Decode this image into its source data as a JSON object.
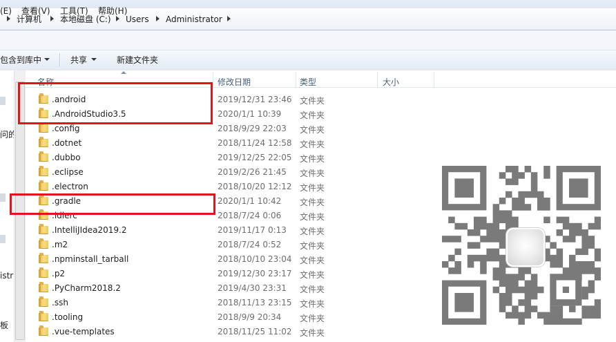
{
  "address_bar": {
    "crumbs": [
      "计算机",
      "本地磁盘 (C:)",
      "Users",
      "Administrator"
    ]
  },
  "menu": [
    "(E)",
    "查看(V)",
    "工具(T)",
    "帮助(H)"
  ],
  "toolbar": {
    "include_library": "包含到库中",
    "share": "共享",
    "new_folder": "新建文件夹"
  },
  "nav": {
    "fragments": [
      "问的",
      "istr",
      "板"
    ]
  },
  "columns": {
    "name": "名称",
    "date": "修改日期",
    "type": "类型",
    "size": "大小"
  },
  "files": [
    {
      "name": ".android",
      "date": "2019/12/31 23:46",
      "type": "文件夹"
    },
    {
      "name": ".AndroidStudio3.5",
      "date": "2020/1/1 10:39",
      "type": "文件夹"
    },
    {
      "name": ".config",
      "date": "2018/9/29 22:03",
      "type": "文件夹"
    },
    {
      "name": ".dotnet",
      "date": "2018/11/24 12:58",
      "type": "文件夹"
    },
    {
      "name": ".dubbo",
      "date": "2019/12/25 22:05",
      "type": "文件夹"
    },
    {
      "name": ".eclipse",
      "date": "2019/2/26 21:45",
      "type": "文件夹"
    },
    {
      "name": ".electron",
      "date": "2018/10/20 12:12",
      "type": "文件夹"
    },
    {
      "name": ".gradle",
      "date": "2020/1/1 10:42",
      "type": "文件夹"
    },
    {
      "name": ".idlerc",
      "date": "2018/7/24 0:06",
      "type": "文件夹"
    },
    {
      "name": ".IntelliJIdea2019.2",
      "date": "2019/11/17 0:13",
      "type": "文件夹"
    },
    {
      "name": ".m2",
      "date": "2018/7/24 0:52",
      "type": "文件夹"
    },
    {
      "name": ".npminstall_tarball",
      "date": "2018/10/10 23:04",
      "type": "文件夹"
    },
    {
      "name": ".p2",
      "date": "2019/12/30 23:17",
      "type": "文件夹"
    },
    {
      "name": ".PyCharm2018.2",
      "date": "2019/4/30 23:31",
      "type": "文件夹"
    },
    {
      "name": ".ssh",
      "date": "2018/11/13 23:15",
      "type": "文件夹"
    },
    {
      "name": ".tooling",
      "date": "2018/9/9 20:34",
      "type": "文件夹"
    },
    {
      "name": ".vue-templates",
      "date": "2018/11/25 11:02",
      "type": "文件夹"
    }
  ],
  "colors": {
    "highlight": "#e3131b",
    "folder": "#f8dd84"
  }
}
